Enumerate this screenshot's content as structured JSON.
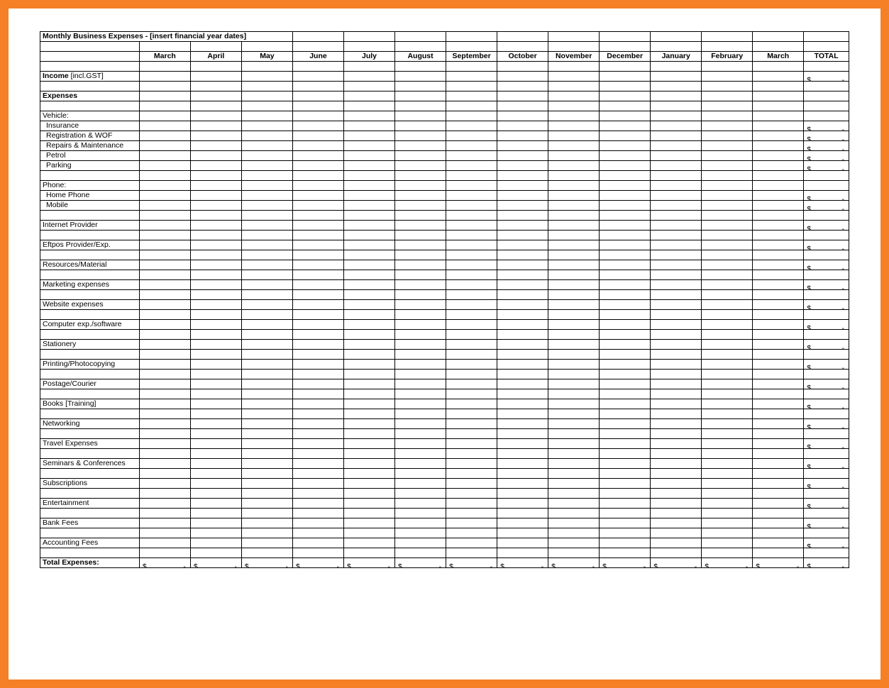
{
  "title_parts": {
    "a": "Monthly Business Expenses - [insert",
    "b": "financial year dates]"
  },
  "months": [
    "March",
    "April",
    "May",
    "June",
    "July",
    "August",
    "September",
    "October",
    "November",
    "December",
    "January",
    "February",
    "March"
  ],
  "total_label": "TOTAL",
  "income": {
    "label_bold": "Income",
    "label_rest": " [incl.GST]"
  },
  "expenses_header": "Expenses",
  "sections": {
    "vehicle": {
      "header": "Vehicle:",
      "items": [
        "Insurance",
        "Registration & WOF",
        "Repairs & Maintenance",
        "Petrol",
        "Parking"
      ]
    },
    "phone": {
      "header": "Phone:",
      "items": [
        "Home Phone",
        "Mobile"
      ]
    }
  },
  "single_rows": [
    "Internet Provider",
    "Eftpos Provider/Exp.",
    "Resources/Material",
    "Marketing expenses",
    "Website expenses",
    "Computer exp./software",
    "Stationery",
    "Printing/Photocopying",
    "Postage/Courier",
    "Books [Training]",
    "Networking",
    "Travel Expenses",
    "Seminars & Conferences",
    "Subscriptions",
    "Entertainment",
    "Bank Fees",
    "Accounting Fees"
  ],
  "total_expenses_label": "Total Expenses:",
  "currency": {
    "symbol": "$",
    "dash": "-"
  }
}
